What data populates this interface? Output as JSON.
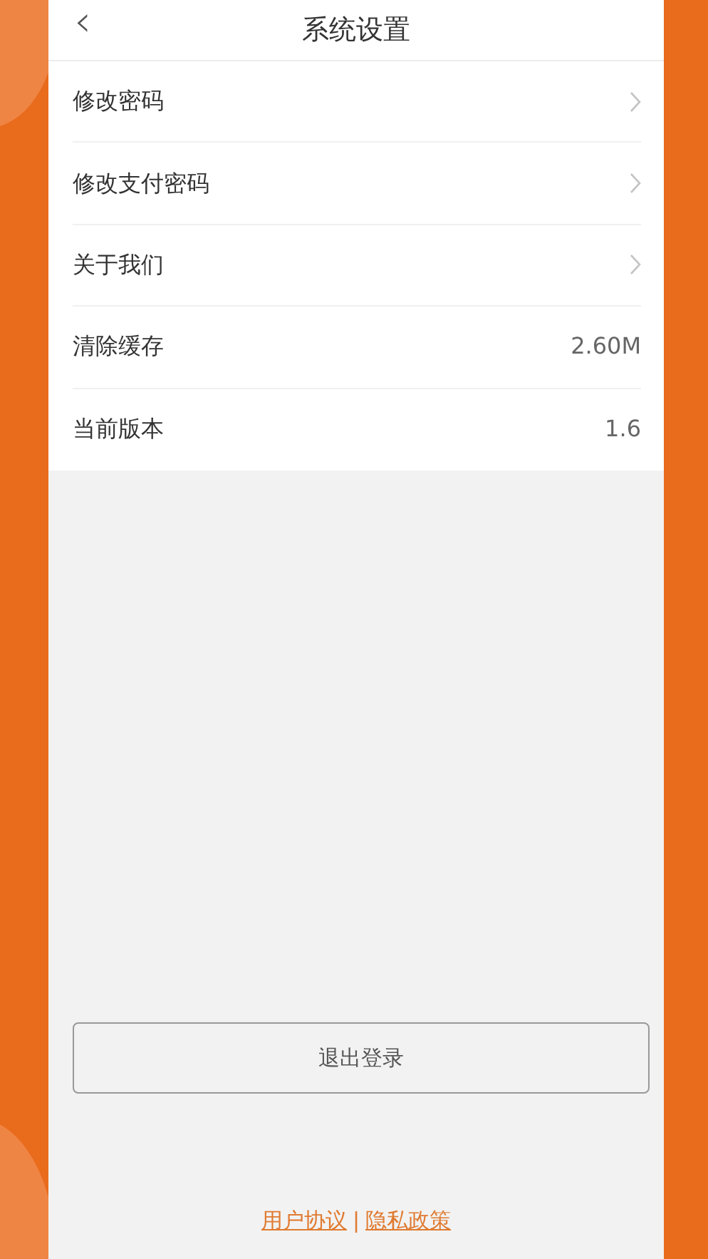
{
  "header": {
    "back_icon": "‹",
    "title": "系统设置"
  },
  "settings": [
    {
      "label": "修改密码",
      "kind": "link"
    },
    {
      "label": "修改支付密码",
      "kind": "link"
    },
    {
      "label": "关于我们",
      "kind": "link"
    },
    {
      "label": "清除缓存",
      "kind": "value",
      "value": "2.60M"
    },
    {
      "label": "当前版本",
      "kind": "value",
      "value": "1.6"
    }
  ],
  "logout_button": "退出登录",
  "footer": {
    "links": [
      "用户协议",
      "隐私政策"
    ],
    "separator": "|"
  }
}
